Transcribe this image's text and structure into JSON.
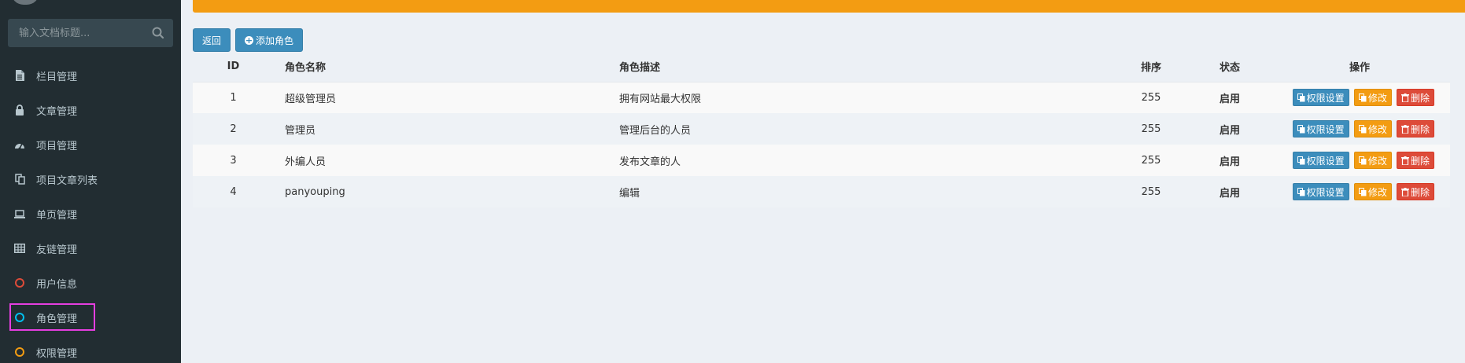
{
  "sidebar": {
    "search_placeholder": "输入文档标题...",
    "items": [
      {
        "label": "栏目管理",
        "icon": "file-icon"
      },
      {
        "label": "文章管理",
        "icon": "lock-icon"
      },
      {
        "label": "项目管理",
        "icon": "dashboard-icon"
      },
      {
        "label": "项目文章列表",
        "icon": "copy-icon"
      },
      {
        "label": "单页管理",
        "icon": "laptop-icon"
      },
      {
        "label": "友链管理",
        "icon": "table-icon"
      },
      {
        "label": "用户信息",
        "icon": "circle-icon",
        "color": "#dd4b39"
      },
      {
        "label": "角色管理",
        "icon": "circle-icon",
        "color": "#00c0ef"
      },
      {
        "label": "权限管理",
        "icon": "circle-icon",
        "color": "#f39c12"
      }
    ]
  },
  "toolbar": {
    "back_label": "返回",
    "add_label": "添加角色"
  },
  "table": {
    "headers": {
      "id": "ID",
      "name": "角色名称",
      "desc": "角色描述",
      "sort": "排序",
      "state": "状态",
      "ops": "操作"
    },
    "rows": [
      {
        "id": "1",
        "name": "超级管理员",
        "desc": "拥有网站最大权限",
        "sort": "255",
        "state": "启用"
      },
      {
        "id": "2",
        "name": "管理员",
        "desc": "管理后台的人员",
        "sort": "255",
        "state": "启用"
      },
      {
        "id": "3",
        "name": "外编人员",
        "desc": "发布文章的人",
        "sort": "255",
        "state": "启用"
      },
      {
        "id": "4",
        "name": "panyouping",
        "desc": "编辑",
        "sort": "255",
        "state": "启用"
      }
    ],
    "actions": {
      "perm": "权限设置",
      "edit": "修改",
      "del": "删除"
    }
  },
  "colors": {
    "sidebar_bg": "#222d32",
    "banner": "#f39c12",
    "primary": "#3c8dbc",
    "warning": "#f39c12",
    "danger": "#dd4b39",
    "highlight_box": "#e53ee0"
  }
}
